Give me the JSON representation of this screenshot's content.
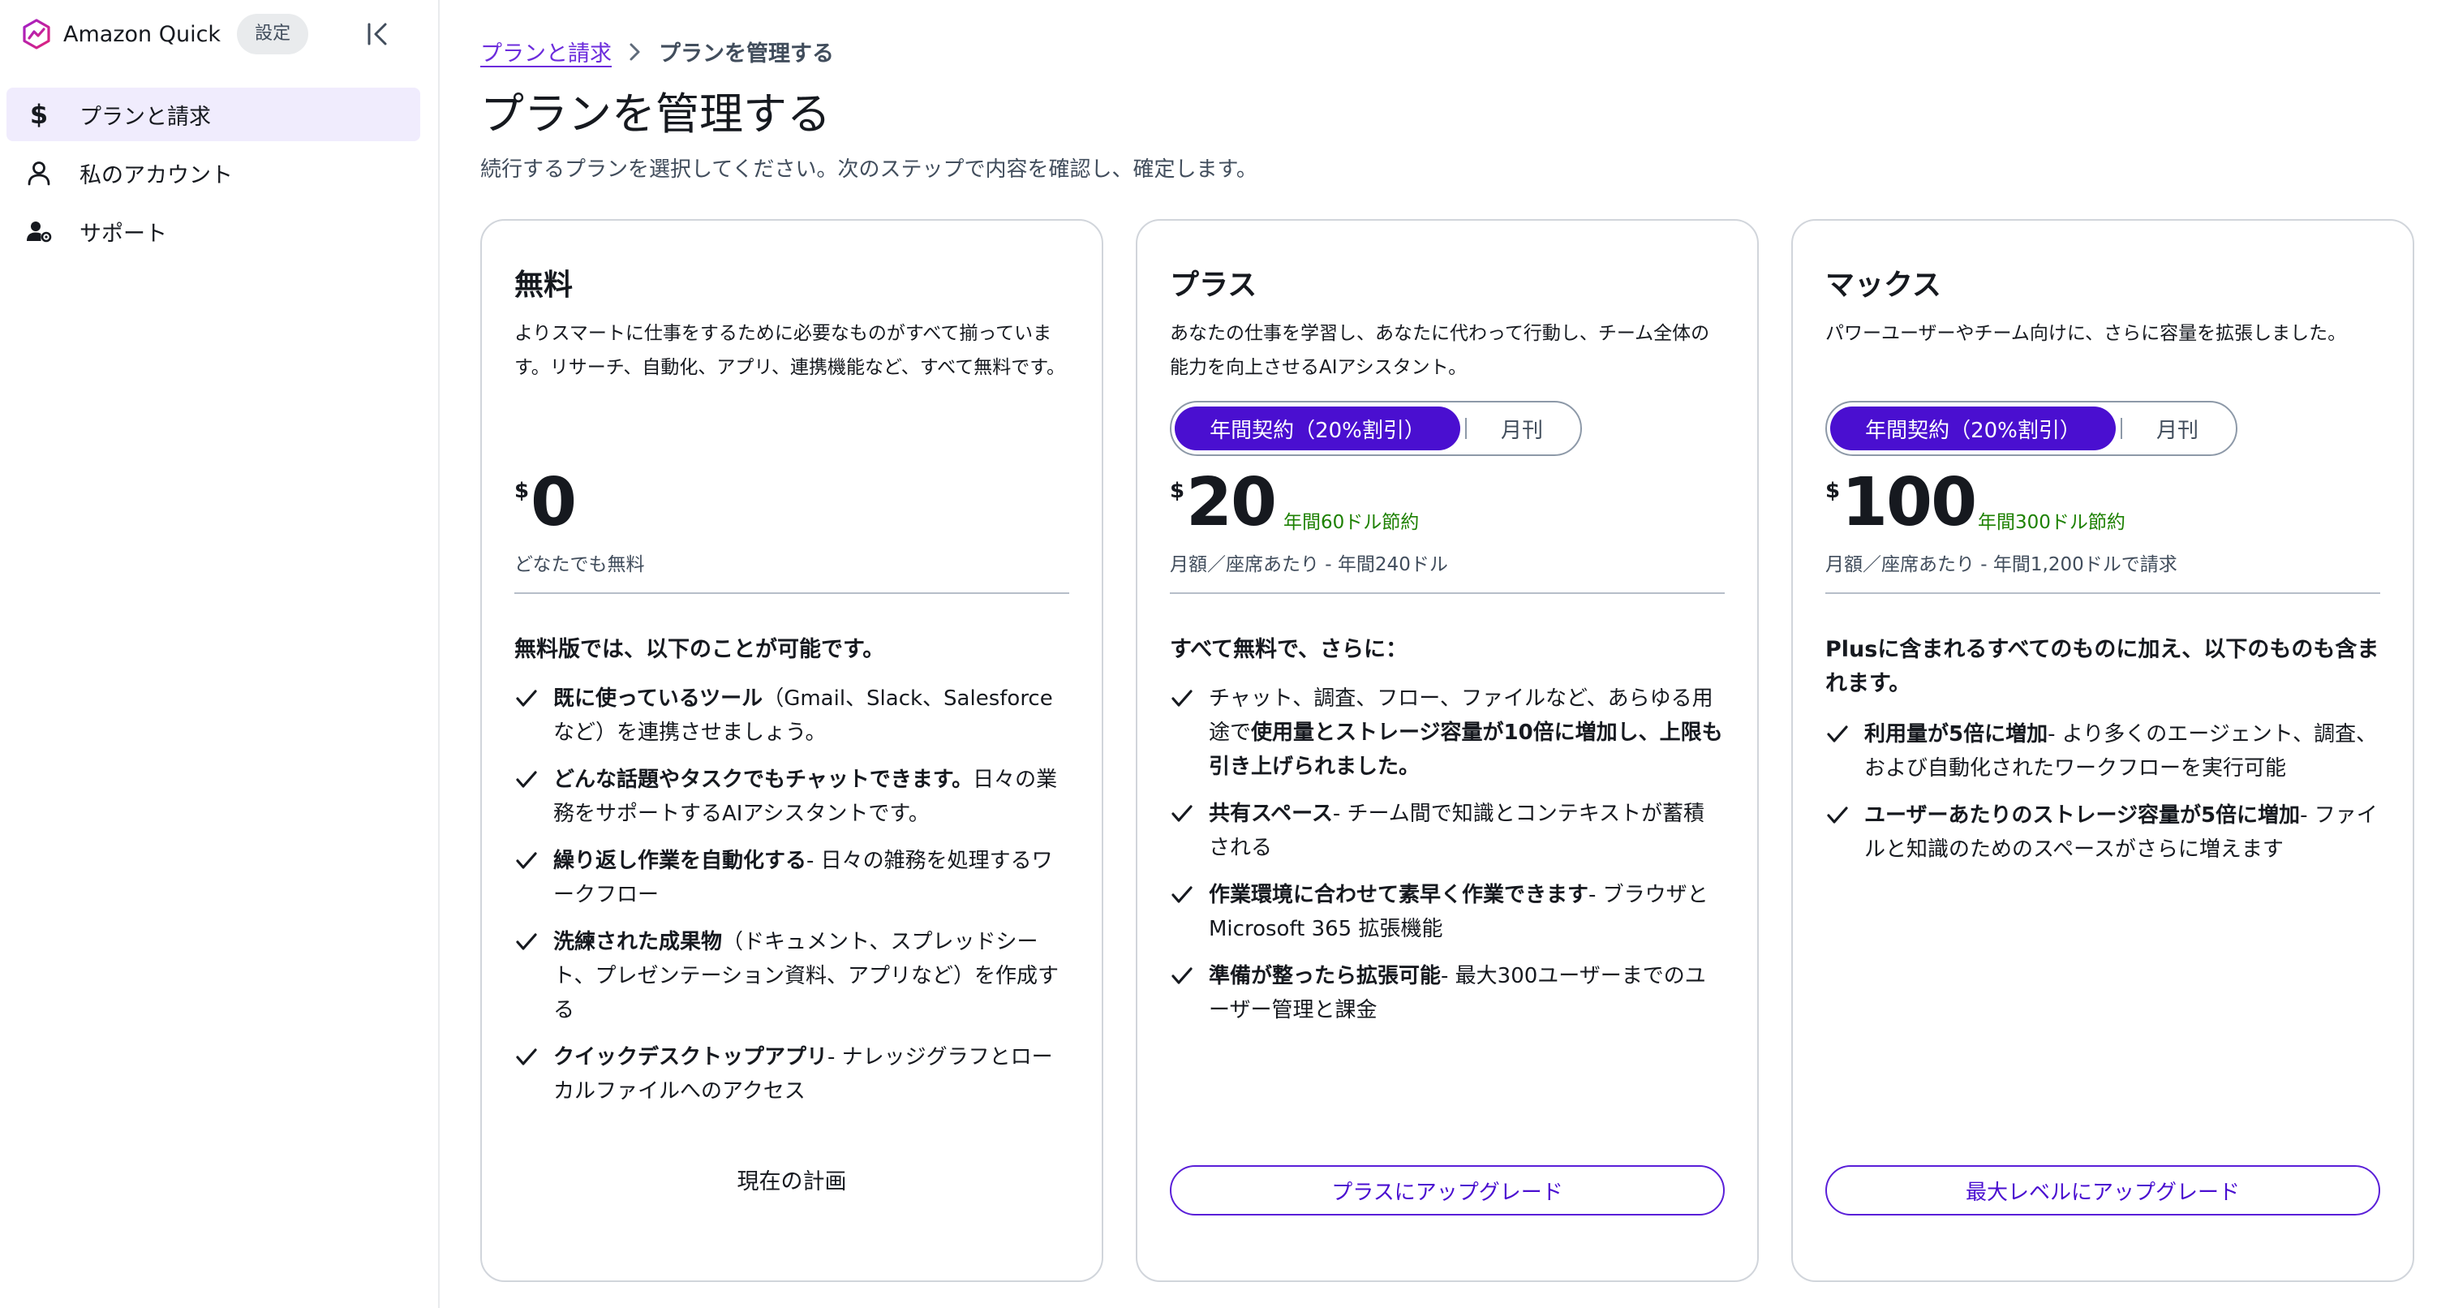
{
  "app": {
    "name": "Amazon Quick",
    "tag": "設定",
    "logo_icon": "amazon-quick-logo-icon",
    "collapse_icon": "collapse-sidebar-icon"
  },
  "sidebar": {
    "items": [
      {
        "label": "プランと請求",
        "icon": "dollar-icon",
        "active": true
      },
      {
        "label": "私のアカウント",
        "icon": "user-icon",
        "active": false
      },
      {
        "label": "サポート",
        "icon": "support-user-icon",
        "active": false
      }
    ]
  },
  "breadcrumb": {
    "parent": "プランと請求",
    "current": "プランを管理する"
  },
  "page": {
    "title": "プランを管理する",
    "description": "続行するプランを選択してください。次のステップで内容を確認し、確定します。"
  },
  "plans": [
    {
      "name": "無料",
      "description": "よりスマートに仕事をするために必要なものがすべて揃っています。リサーチ、自動化、アプリ、連携機能など、すべて無料です。",
      "currency": "$",
      "price": "0",
      "price_note": "どなたでも無料",
      "features_heading": "無料版では、以下のことが可能です。",
      "features": [
        {
          "bold": "既に使っているツール",
          "text": "（Gmail、Slack、Salesforce など）を連携させましょう。"
        },
        {
          "bold": "どんな話題やタスクでもチャットできます。",
          "text": "日々の業務をサポートするAIアシスタントです。"
        },
        {
          "bold": "繰り返し作業を自動化する",
          "text": "- 日々の雑務を処理するワークフロー"
        },
        {
          "bold": "洗練された成果物",
          "text": "（ドキュメント、スプレッドシート、プレゼンテーション資料、アプリなど）を作成する"
        },
        {
          "bold": "クイックデスクトップアプリ",
          "text": "- ナレッジグラフとローカルファイルへのアクセス"
        }
      ],
      "action_label": "現在の計画"
    },
    {
      "name": "プラス",
      "description": "あなたの仕事を学習し、あなたに代わって行動し、チーム全体の能力を向上させるAIアシスタント。",
      "billing_toggle": {
        "annual": "年間契約（20%割引）",
        "monthly": "月刊",
        "selected": "annual"
      },
      "currency": "$",
      "price": "20",
      "savings": "年間60ドル節約",
      "price_note": "月額／座席あたり - 年間240ドル",
      "features_heading": "すべて無料で、さらに：",
      "features": [
        {
          "pre": "チャット、調査、フロー、ファイルなど、あらゆる用途で",
          "bold": "使用量とストレージ容量が10倍に増加し、上限も引き上げられました。",
          "text": ""
        },
        {
          "bold": "共有スペース",
          "text": "- チーム間で知識とコンテキストが蓄積される"
        },
        {
          "bold": "作業環境に合わせて素早く作業できます",
          "text": "- ブラウザと Microsoft 365 拡張機能"
        },
        {
          "bold": "準備が整ったら拡張可能",
          "text": "- 最大300ユーザーまでのユーザー管理と課金"
        }
      ],
      "action_label": "プラスにアップグレード"
    },
    {
      "name": "マックス",
      "description": "パワーユーザーやチーム向けに、さらに容量を拡張しました。",
      "billing_toggle": {
        "annual": "年間契約（20%割引）",
        "monthly": "月刊",
        "selected": "annual"
      },
      "currency": "$",
      "price": "100",
      "savings": "年間300ドル節約",
      "price_note": "月額／座席あたり - 年間1,200ドルで請求",
      "features_heading": "Plusに含まれるすべてのものに加え、以下のものも含まれます。",
      "features": [
        {
          "bold": "利用量が5倍に増加",
          "text": "- より多くのエージェント、調査、および自動化されたワークフローを実行可能"
        },
        {
          "bold": "ユーザーあたりのストレージ容量が5倍に増加",
          "text": "- ファイルと知識のためのスペースがさらに増えます"
        }
      ],
      "action_label": "最大レベルにアップグレード"
    }
  ],
  "colors": {
    "accent": "#4a0fd0",
    "accent_light": "#f0ecfd",
    "link": "#6c2cdc",
    "savings": "#1d8102",
    "border": "#d1d5db"
  }
}
